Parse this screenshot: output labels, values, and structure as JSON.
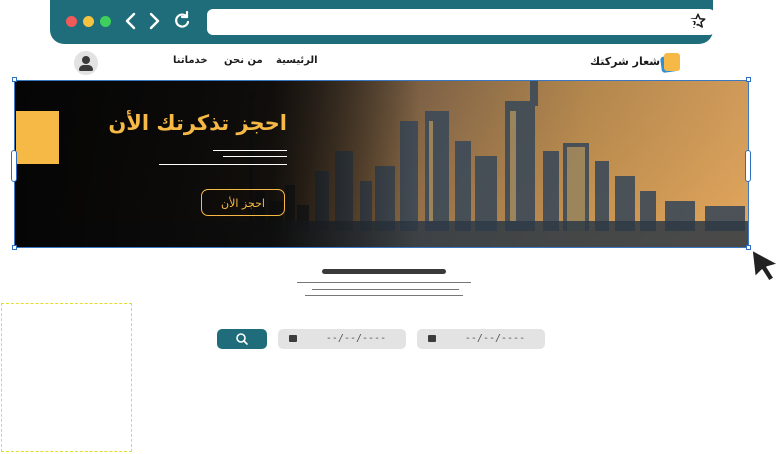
{
  "browser": {
    "address": "",
    "icons": [
      "back-icon",
      "forward-icon",
      "reload-icon",
      "star-icon",
      "menu-icon"
    ],
    "window_dots": [
      "#f25a5a",
      "#f5c242",
      "#3fcf5c"
    ]
  },
  "site_nav": {
    "logo_text": "شعار شركتك",
    "links": [
      "الرئيسية",
      "من نحن",
      "خدماتنا"
    ]
  },
  "hero": {
    "title": "احجز تذكرتك الأن",
    "cta_label": "احجز الأن"
  },
  "search": {
    "date_from": "--/--/----",
    "date_to": "--/--/----"
  },
  "colors": {
    "brand_teal": "#1f6d7a",
    "accent_gold": "#f6b945",
    "selection_blue": "#2d6fc2",
    "dashed_yellow": "#e2dd2b"
  }
}
